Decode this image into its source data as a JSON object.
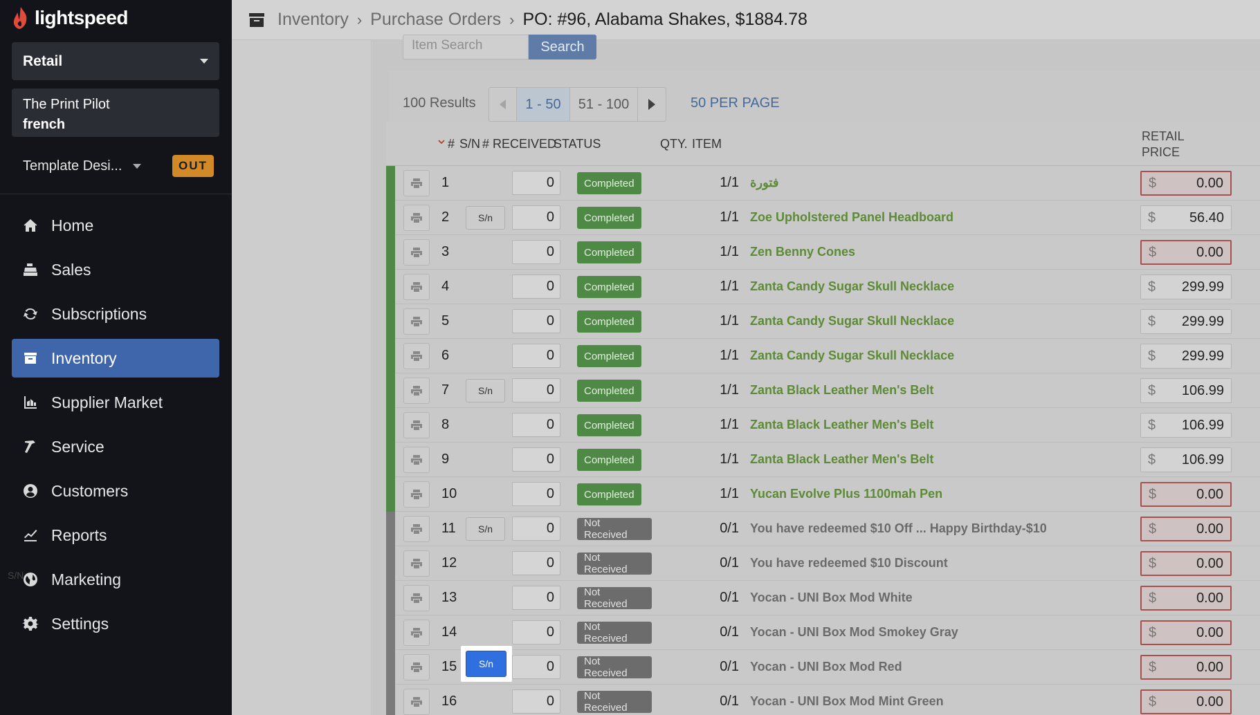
{
  "brand": {
    "name": "lightspeed"
  },
  "sidebar": {
    "shop": "Retail",
    "register_line1": "The Print Pilot",
    "register_line2": "french",
    "template": "Template Desi...",
    "status_badge": "OUT",
    "stray_text": "S/N",
    "nav": [
      {
        "label": "Home",
        "icon": "home-icon"
      },
      {
        "label": "Sales",
        "icon": "register-icon"
      },
      {
        "label": "Subscriptions",
        "icon": "refresh-icon"
      },
      {
        "label": "Inventory",
        "icon": "box-icon",
        "active": true
      },
      {
        "label": "Supplier Market",
        "icon": "market-icon"
      },
      {
        "label": "Service",
        "icon": "hammer-icon"
      },
      {
        "label": "Customers",
        "icon": "user-icon"
      },
      {
        "label": "Reports",
        "icon": "chart-icon"
      },
      {
        "label": "Marketing",
        "icon": "globe-icon"
      },
      {
        "label": "Settings",
        "icon": "gear-icon"
      }
    ]
  },
  "header": {
    "crumbs": [
      "Inventory",
      "Purchase Orders"
    ],
    "title": "PO: #96, Alabama Shakes, $1884.78"
  },
  "search": {
    "placeholder": "Item Search",
    "button": "Search"
  },
  "pagination": {
    "results": "100 Results",
    "page1": "1 - 50",
    "page2": "51 - 100",
    "per_page": "50 PER PAGE"
  },
  "table": {
    "headers": {
      "num": "#",
      "sn": "S/N",
      "received": "# RECEIVED",
      "status": "STATUS",
      "qty": "QTY.",
      "item": "ITEM",
      "price1": "RETAIL",
      "price2": "PRICE"
    },
    "currency": "$",
    "sn_label": "S/n",
    "rows": [
      {
        "num": "1",
        "sn": false,
        "received": "0",
        "status": "Completed",
        "qty": "1/1",
        "item": "فتورة",
        "price": "0.00",
        "warn": true
      },
      {
        "num": "2",
        "sn": true,
        "received": "0",
        "status": "Completed",
        "qty": "1/1",
        "item": "Zoe Upholstered Panel Headboard",
        "price": "56.40",
        "warn": false
      },
      {
        "num": "3",
        "sn": false,
        "received": "0",
        "status": "Completed",
        "qty": "1/1",
        "item": "Zen Benny Cones",
        "price": "0.00",
        "warn": true
      },
      {
        "num": "4",
        "sn": false,
        "received": "0",
        "status": "Completed",
        "qty": "1/1",
        "item": "Zanta Candy Sugar Skull Necklace",
        "price": "299.99",
        "warn": false
      },
      {
        "num": "5",
        "sn": false,
        "received": "0",
        "status": "Completed",
        "qty": "1/1",
        "item": "Zanta Candy Sugar Skull Necklace",
        "price": "299.99",
        "warn": false
      },
      {
        "num": "6",
        "sn": false,
        "received": "0",
        "status": "Completed",
        "qty": "1/1",
        "item": "Zanta Candy Sugar Skull Necklace",
        "price": "299.99",
        "warn": false
      },
      {
        "num": "7",
        "sn": true,
        "received": "0",
        "status": "Completed",
        "qty": "1/1",
        "item": "Zanta Black Leather Men's Belt",
        "price": "106.99",
        "warn": false
      },
      {
        "num": "8",
        "sn": false,
        "received": "0",
        "status": "Completed",
        "qty": "1/1",
        "item": "Zanta Black Leather Men's Belt",
        "price": "106.99",
        "warn": false
      },
      {
        "num": "9",
        "sn": false,
        "received": "0",
        "status": "Completed",
        "qty": "1/1",
        "item": "Zanta Black Leather Men's Belt",
        "price": "106.99",
        "warn": false
      },
      {
        "num": "10",
        "sn": false,
        "received": "0",
        "status": "Completed",
        "qty": "1/1",
        "item": "Yucan Evolve Plus 1100mah Pen",
        "price": "0.00",
        "warn": true
      },
      {
        "num": "11",
        "sn": true,
        "received": "0",
        "status": "Not Received",
        "qty": "0/1",
        "item": "You have redeemed $10 Off ... Happy Birthday-$10",
        "price": "0.00",
        "warn": true
      },
      {
        "num": "12",
        "sn": false,
        "received": "0",
        "status": "Not Received",
        "qty": "0/1",
        "item": "You have redeemed $10 Discount",
        "price": "0.00",
        "warn": true
      },
      {
        "num": "13",
        "sn": false,
        "received": "0",
        "status": "Not Received",
        "qty": "0/1",
        "item": "Yocan - UNI Box Mod White",
        "price": "0.00",
        "warn": true
      },
      {
        "num": "14",
        "sn": false,
        "received": "0",
        "status": "Not Received",
        "qty": "0/1",
        "item": "Yocan - UNI Box Mod Smokey Gray",
        "price": "0.00",
        "warn": true
      },
      {
        "num": "15",
        "sn": false,
        "received": "0",
        "status": "Not Received",
        "qty": "0/1",
        "item": "Yocan - UNI Box Mod Red",
        "price": "0.00",
        "warn": true
      },
      {
        "num": "16",
        "sn": false,
        "received": "0",
        "status": "Not Received",
        "qty": "0/1",
        "item": "Yocan - UNI Box Mod Mint Green",
        "price": "0.00",
        "warn": true
      }
    ],
    "highlighted_sn": "S/n"
  },
  "colors": {
    "accent": "#3f66aa",
    "completed": "#4e8a46",
    "not_received": "#6c6c6c",
    "link_green": "#5d8a36",
    "highlight": "#2f6fe0",
    "out_badge": "#d28a28"
  }
}
